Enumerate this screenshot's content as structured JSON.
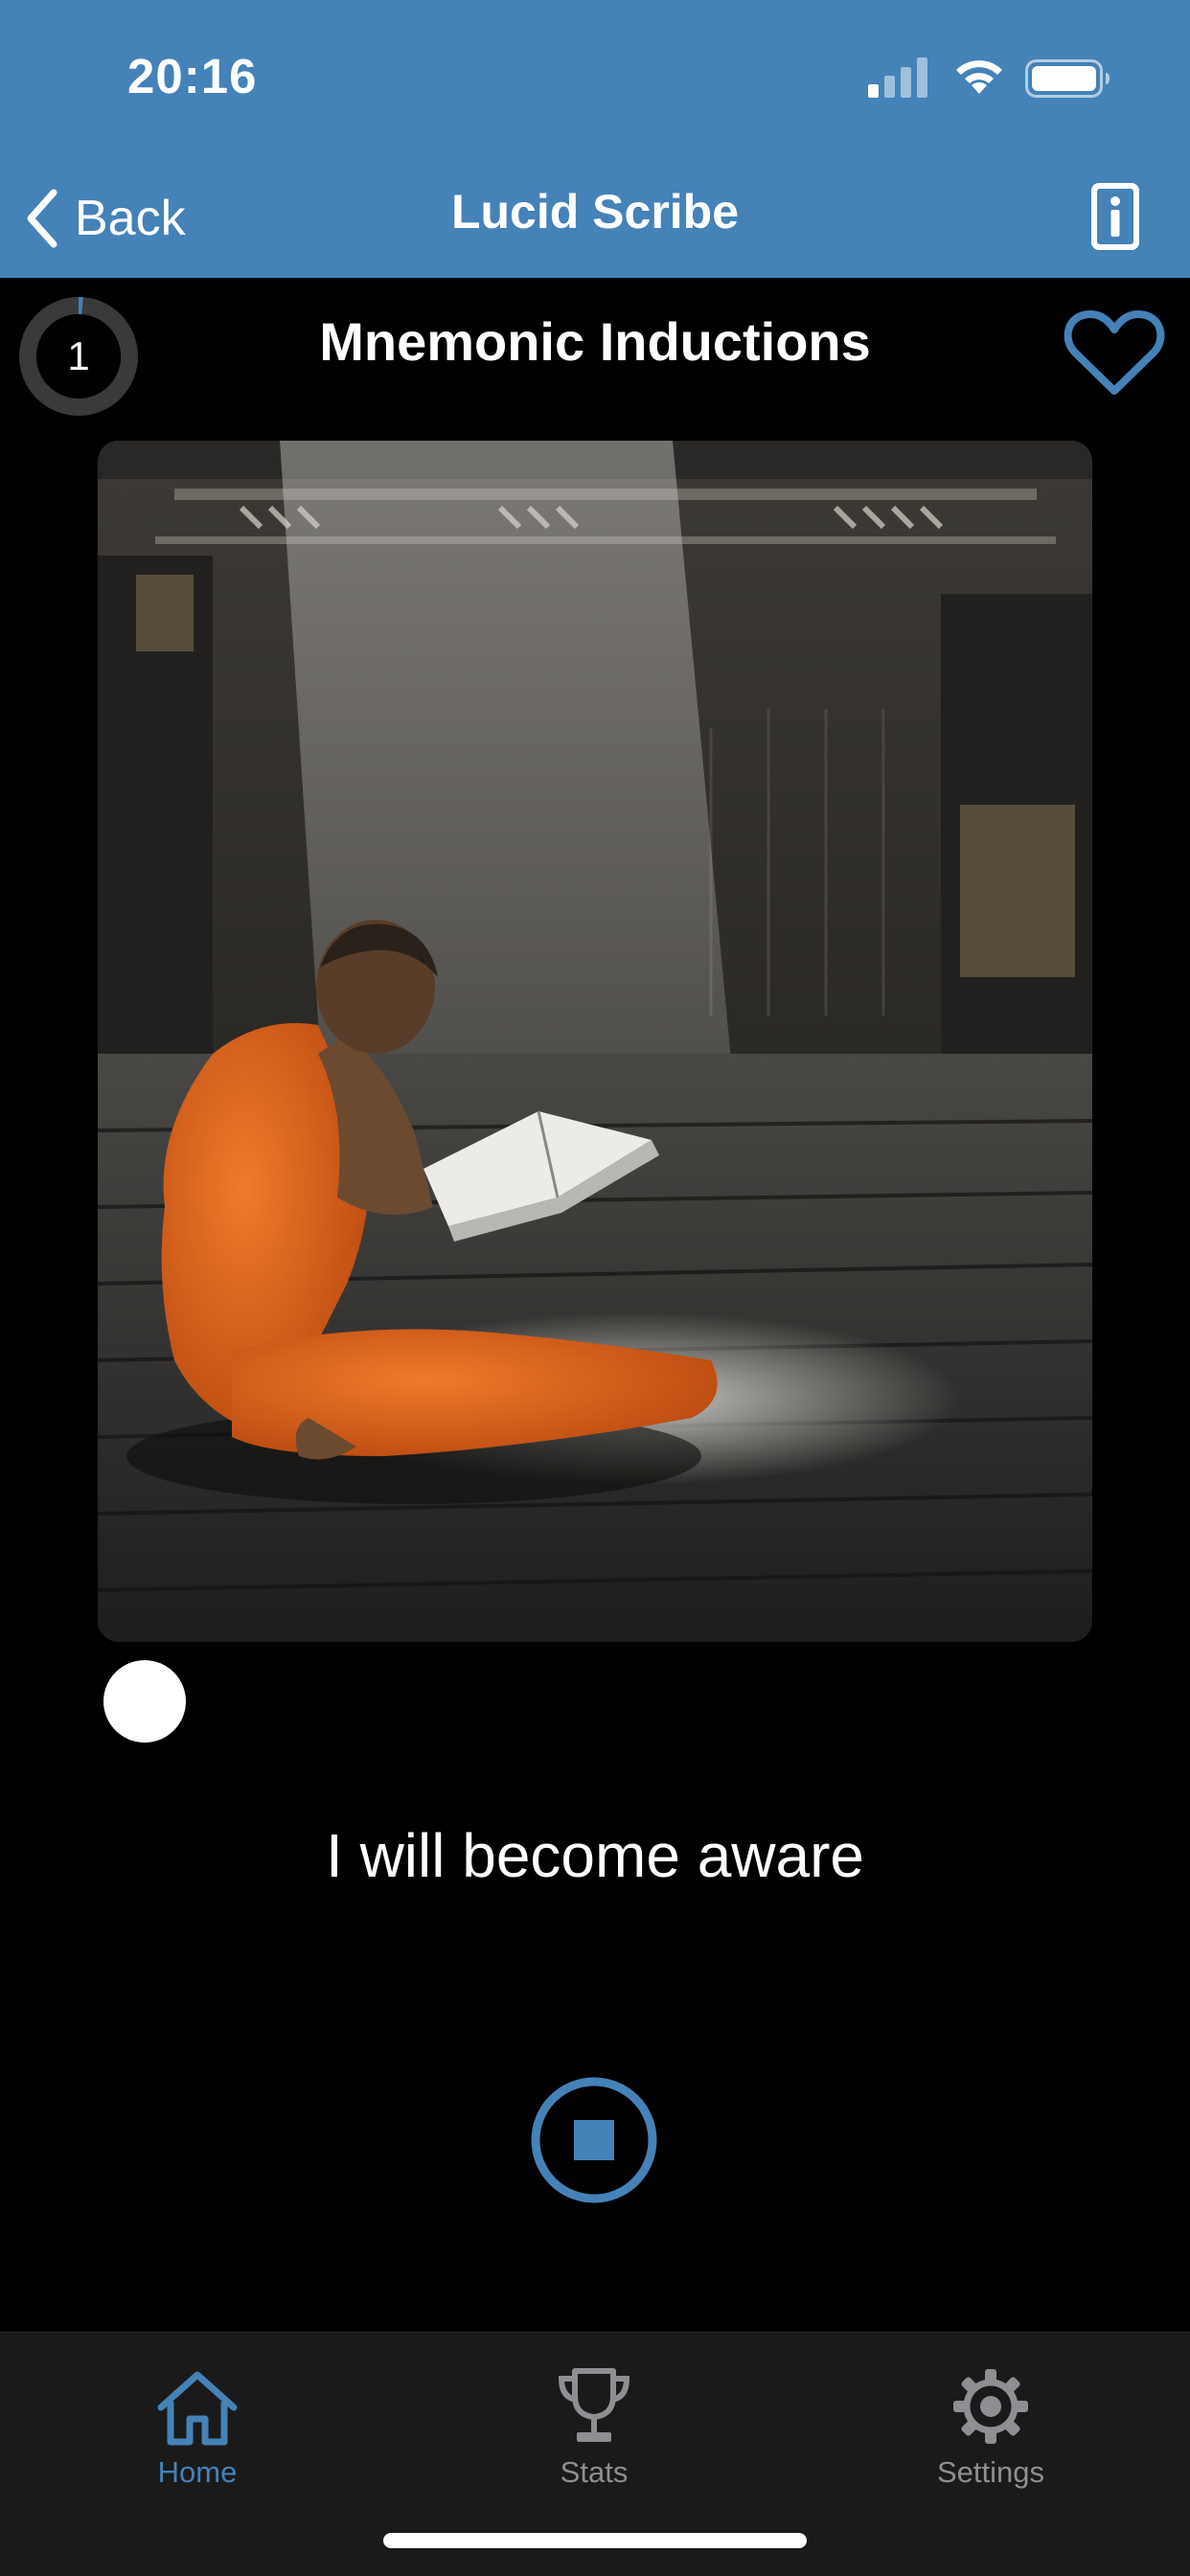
{
  "status_bar": {
    "time": "20:16",
    "icons": [
      "cellular-signal-icon",
      "wifi-icon",
      "battery-icon"
    ]
  },
  "nav": {
    "back_label": "Back",
    "title": "Lucid Scribe",
    "icons": [
      "chevron-left-icon",
      "info-icon"
    ]
  },
  "session": {
    "counter": "1",
    "title": "Mnemonic Inductions",
    "favorite_icon": "heart-outline-icon",
    "artwork_description_icon": "monk-reading-image",
    "progress_fraction": 0.0,
    "affirmation": "I will become aware",
    "control_icon": "stop-icon"
  },
  "tabs": [
    {
      "label": "Home",
      "icon": "home-icon",
      "active": true
    },
    {
      "label": "Stats",
      "icon": "trophy-icon",
      "active": false
    },
    {
      "label": "Settings",
      "icon": "gear-icon",
      "active": false
    }
  ],
  "colors": {
    "accent": "#4482b8",
    "background": "#000000",
    "tab_bar": "#1a1a1a",
    "inactive_tab": "#8e8e93"
  }
}
